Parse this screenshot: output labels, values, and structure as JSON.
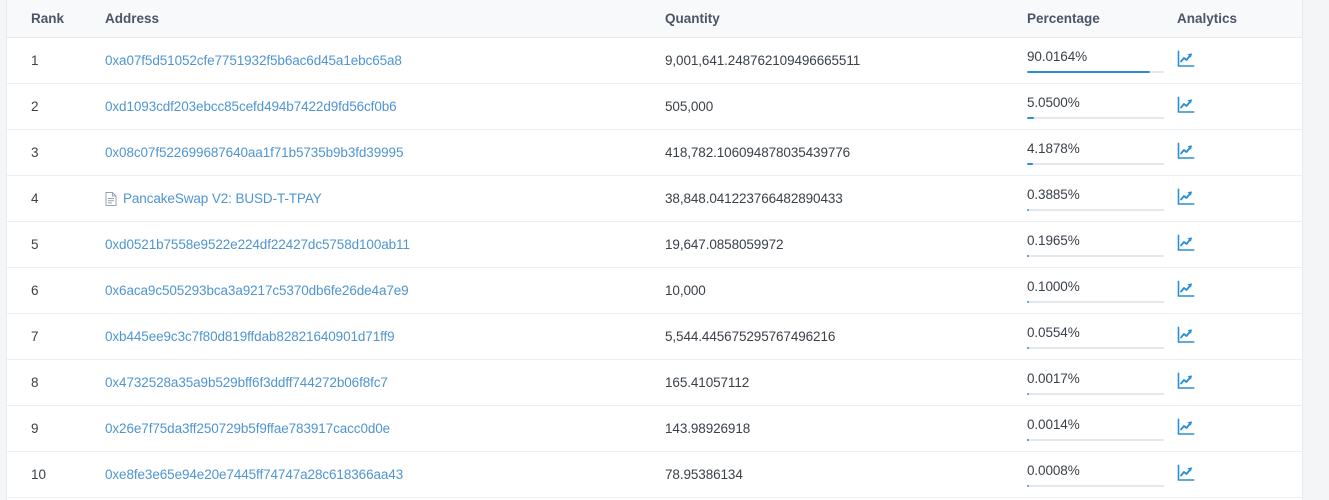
{
  "table": {
    "columns": [
      {
        "key": "rank",
        "label": "Rank"
      },
      {
        "key": "address",
        "label": "Address"
      },
      {
        "key": "quantity",
        "label": "Quantity"
      },
      {
        "key": "percentage",
        "label": "Percentage"
      },
      {
        "key": "analytics",
        "label": "Analytics"
      }
    ],
    "rows": [
      {
        "rank": "1",
        "address": "0xa07f5d51052cfe7751932f5b6ac6d45a1ebc65a8",
        "is_contract": false,
        "quantity": "9,001,641.248762109496665511",
        "percentage": "90.0164%",
        "percentage_value": 90.0164,
        "analytics_icon": "analytics-chart-icon"
      },
      {
        "rank": "2",
        "address": "0xd1093cdf203ebcc85cefd494b7422d9fd56cf0b6",
        "is_contract": false,
        "quantity": "505,000",
        "percentage": "5.0500%",
        "percentage_value": 5.05,
        "analytics_icon": "analytics-chart-icon"
      },
      {
        "rank": "3",
        "address": "0x08c07f522699687640aa1f71b5735b9b3fd39995",
        "is_contract": false,
        "quantity": "418,782.106094878035439776",
        "percentage": "4.1878%",
        "percentage_value": 4.1878,
        "analytics_icon": "analytics-chart-icon"
      },
      {
        "rank": "4",
        "address": "PancakeSwap V2: BUSD-T-TPAY",
        "is_contract": true,
        "contract_icon": "contract-document-icon",
        "quantity": "38,848.041223766482890433",
        "percentage": "0.3885%",
        "percentage_value": 0.3885,
        "analytics_icon": "analytics-chart-icon"
      },
      {
        "rank": "5",
        "address": "0xd0521b7558e9522e224df22427dc5758d100ab11",
        "is_contract": false,
        "quantity": "19,647.0858059972",
        "percentage": "0.1965%",
        "percentage_value": 0.1965,
        "analytics_icon": "analytics-chart-icon"
      },
      {
        "rank": "6",
        "address": "0x6aca9c505293bca3a9217c5370db6fe26de4a7e9",
        "is_contract": false,
        "quantity": "10,000",
        "percentage": "0.1000%",
        "percentage_value": 0.1,
        "analytics_icon": "analytics-chart-icon"
      },
      {
        "rank": "7",
        "address": "0xb445ee9c3c7f80d819ffdab82821640901d71ff9",
        "is_contract": false,
        "quantity": "5,544.445675295767496216",
        "percentage": "0.0554%",
        "percentage_value": 0.0554,
        "analytics_icon": "analytics-chart-icon"
      },
      {
        "rank": "8",
        "address": "0x4732528a35a9b529bff6f3ddff744272b06f8fc7",
        "is_contract": false,
        "quantity": "165.41057112",
        "percentage": "0.0017%",
        "percentage_value": 0.0017,
        "analytics_icon": "analytics-chart-icon"
      },
      {
        "rank": "9",
        "address": "0x26e7f75da3ff250729b5f9ffae783917cacc0d0e",
        "is_contract": false,
        "quantity": "143.98926918",
        "percentage": "0.0014%",
        "percentage_value": 0.0014,
        "analytics_icon": "analytics-chart-icon"
      },
      {
        "rank": "10",
        "address": "0xe8fe3e65e94e20e7445ff74747a28c618366aa43",
        "is_contract": false,
        "quantity": "78.95386134",
        "percentage": "0.0008%",
        "percentage_value": 0.0008,
        "analytics_icon": "analytics-chart-icon"
      }
    ]
  },
  "colors": {
    "link": "#4f95d1",
    "progress_fill": "#2a8fd4",
    "progress_track": "#e4e7eb",
    "header_bg": "#f8f9fa",
    "header_text": "#4a5568",
    "body_text": "#3b4149",
    "row_border": "#eceef1",
    "page_bg": "#f4f5f7"
  }
}
